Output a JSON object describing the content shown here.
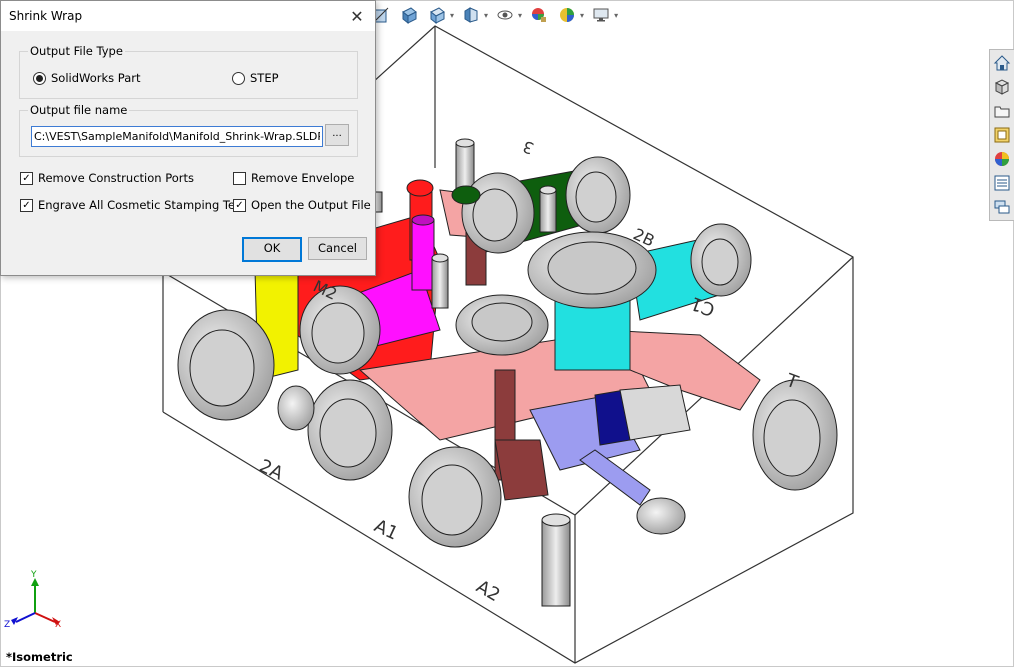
{
  "dialog": {
    "title": "Shrink Wrap",
    "output_type": {
      "label": "Output File Type",
      "options": [
        "SolidWorks Part",
        "STEP"
      ],
      "selected": "SolidWorks Part"
    },
    "output_name": {
      "label": "Output file name",
      "value": "C:\\VEST\\SampleManifold\\Manifold_Shrink-Wrap.SLDPRT",
      "browse_label": "..."
    },
    "options": [
      {
        "label": "Remove Construction Ports",
        "checked": true
      },
      {
        "label": "Remove Envelope",
        "checked": false
      },
      {
        "label": "Engrave All Cosmetic Stamping Text",
        "checked": true
      },
      {
        "label": "Open the Output File",
        "checked": true
      }
    ],
    "ok_label": "OK",
    "cancel_label": "Cancel"
  },
  "viewport": {
    "view_name": "*Isometric",
    "port_labels": [
      "2A",
      "A1",
      "A2",
      "M2",
      "2B",
      "C1",
      "T",
      "3"
    ],
    "triad": {
      "x": "X",
      "y": "Y",
      "z": "Z"
    }
  },
  "toolbar_icons": [
    "section-view-icon",
    "view-orientation-icon",
    "display-style-icon",
    "hide-show-icon",
    "edit-appearance-icon",
    "apply-scene-icon",
    "view-settings-icon"
  ],
  "task_pane_icons": [
    "home-icon",
    "design-library-icon",
    "file-explorer-icon",
    "view-palette-icon",
    "appearances-icon",
    "custom-properties-icon",
    "forum-icon"
  ],
  "colors": {
    "accent": "#0078d7",
    "block_edge": "#333333",
    "red": "#ff1c1c",
    "magenta": "#ff10ff",
    "yellow": "#f2f200",
    "green": "#0e5e0e",
    "cyan": "#22e0e0",
    "salmon": "#f4a4a4",
    "lavender": "#9c9cf0",
    "navy": "#10108c",
    "maroon": "#8c3c3c",
    "grey": "#c8c8c8"
  }
}
